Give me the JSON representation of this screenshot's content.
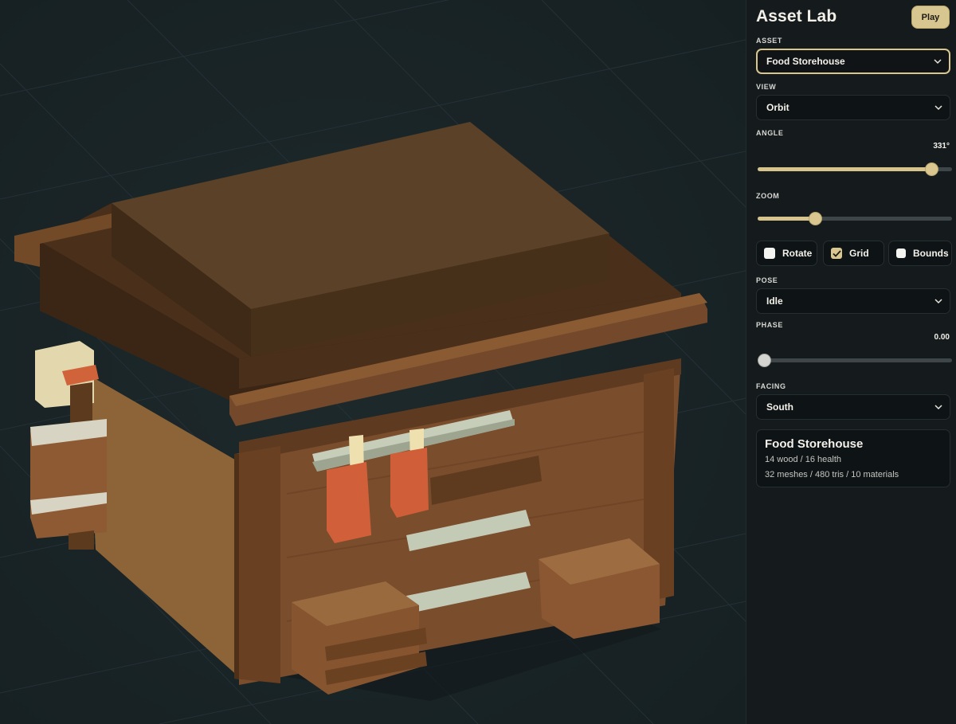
{
  "app": {
    "title": "Asset Lab",
    "play_label": "Play"
  },
  "controls": {
    "asset": {
      "label": "ASSET",
      "value": "Food Storehouse"
    },
    "view": {
      "label": "VIEW",
      "value": "Orbit"
    },
    "angle": {
      "label": "ANGLE",
      "value_text": "331°",
      "value": 331,
      "min": 0,
      "max": 360
    },
    "zoom": {
      "label": "ZOOM",
      "fraction": 0.28
    },
    "toggles": [
      {
        "label": "Rotate",
        "checked": false
      },
      {
        "label": "Grid",
        "checked": true
      },
      {
        "label": "Bounds",
        "checked": false
      }
    ],
    "pose": {
      "label": "POSE",
      "value": "Idle"
    },
    "phase": {
      "label": "PHASE",
      "value_text": "0.00",
      "value": 0.0
    },
    "facing": {
      "label": "FACING",
      "value": "South"
    }
  },
  "info": {
    "name": "Food Storehouse",
    "stats_line": "14 wood / 16 health",
    "mesh_line": "32 meshes / 480 tris / 10 materials"
  },
  "colors": {
    "accent": "#d9c78f",
    "viewport_bg": "#1a2426",
    "panel_bg": "#151b1d"
  },
  "icons": [
    "chevron-down-icon",
    "check-icon"
  ]
}
